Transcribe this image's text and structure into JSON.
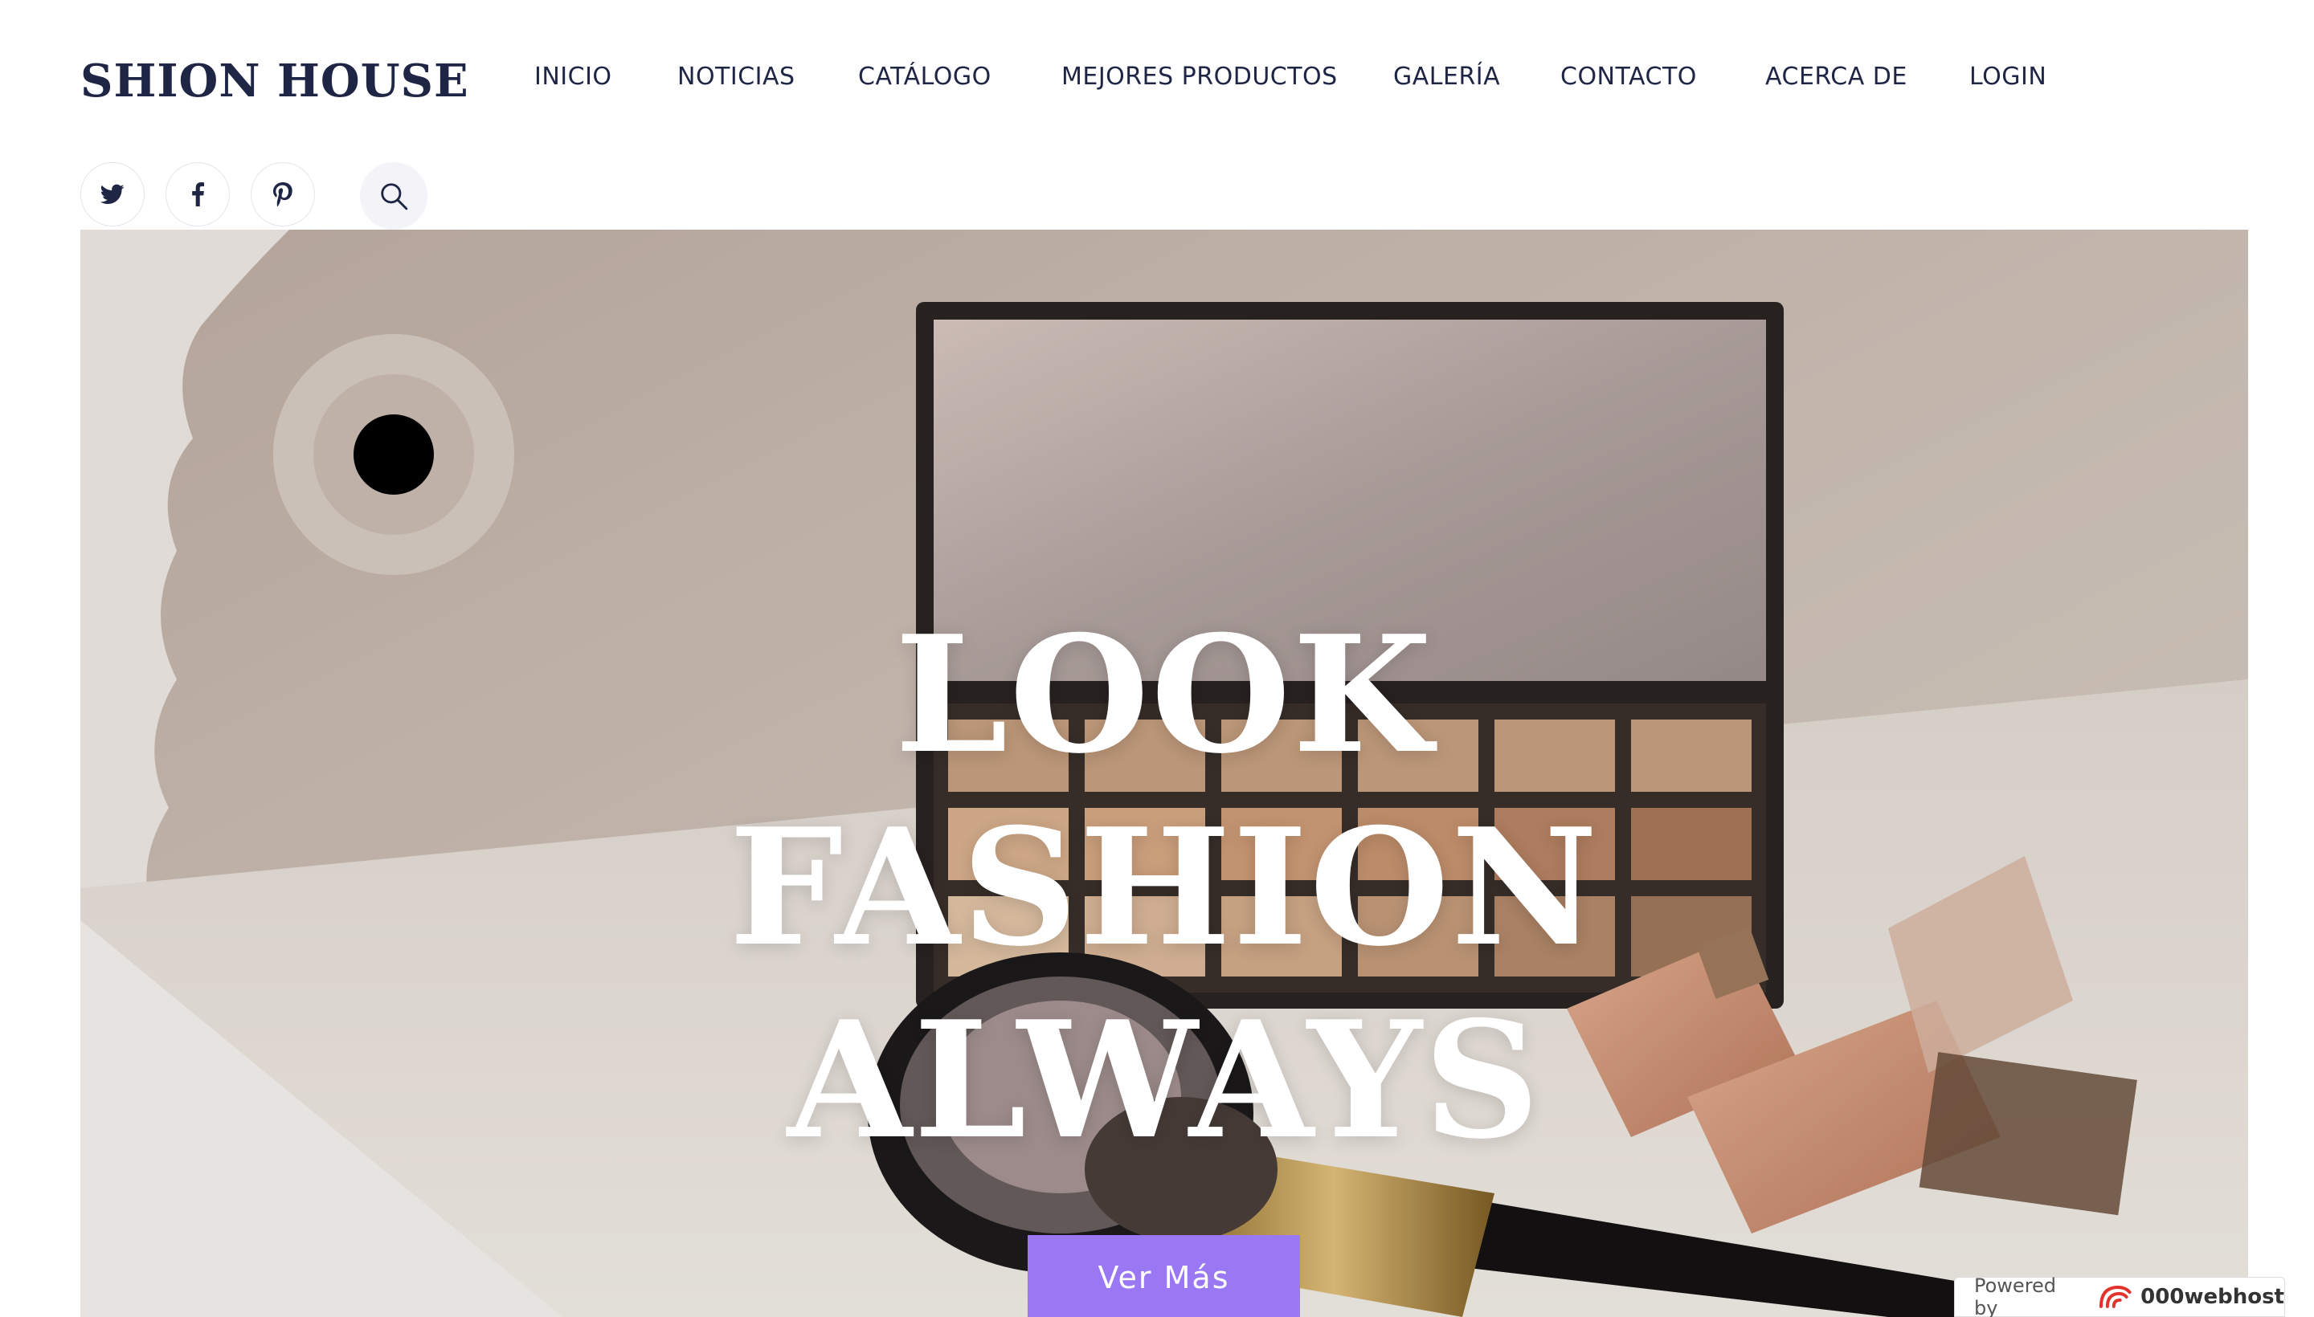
{
  "header": {
    "logo": "SHION HOUSE",
    "nav": [
      {
        "label": "INICIO"
      },
      {
        "label": "NOTICIAS"
      },
      {
        "label": "CATÁLOGO"
      },
      {
        "label": "MEJORES PRODUCTOS"
      },
      {
        "label": "GALERÍA"
      },
      {
        "label": "CONTACTO"
      },
      {
        "label": "ACERCA DE"
      },
      {
        "label": "LOGIN"
      }
    ],
    "social_icons": [
      "twitter-icon",
      "facebook-icon",
      "pinterest-icon"
    ],
    "search_icon": "search-icon"
  },
  "hero": {
    "title_lines": [
      "LOOK",
      "FASHION",
      "ALWAYS"
    ],
    "cta_label": "Ver Más"
  },
  "footer_badge": {
    "powered_by": "Powered by",
    "brand": "000webhost"
  },
  "colors": {
    "brand_text": "#1f2545",
    "accent": "#9a78f3",
    "background": "#ffffff"
  }
}
